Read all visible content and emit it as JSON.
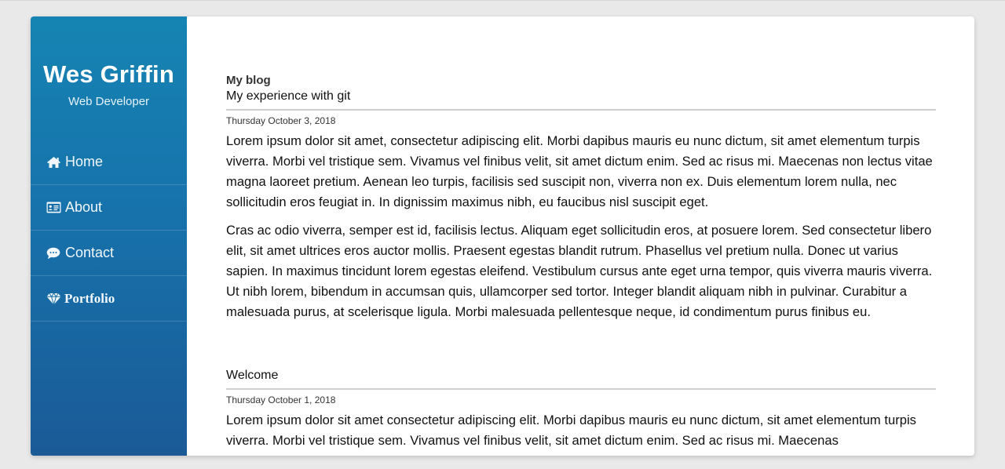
{
  "sidebar": {
    "name": "Wes Griffin",
    "subtitle": "Web Developer",
    "items": [
      {
        "label": "Home",
        "icon": "home-icon"
      },
      {
        "label": "About",
        "icon": "id-card-icon"
      },
      {
        "label": "Contact",
        "icon": "chat-bubble-icon"
      },
      {
        "label": "Portfolio",
        "icon": "diamond-icon"
      }
    ]
  },
  "main": {
    "heading": "My blog",
    "posts": [
      {
        "title": "My experience with git",
        "date": "Thursday October 3, 2018",
        "paragraphs": [
          "Lorem ipsum dolor sit amet, consectetur adipiscing elit. Morbi dapibus mauris eu nunc dictum, sit amet elementum turpis viverra. Morbi vel tristique sem. Vivamus vel finibus velit, sit amet dictum enim. Sed ac risus mi. Maecenas non lectus vitae magna laoreet pretium. Aenean leo turpis, facilisis sed suscipit non, viverra non ex. Duis elementum lorem nulla, nec sollicitudin eros feugiat in. In dignissim maximus nibh, eu faucibus nisl suscipit eget.",
          "Cras ac odio viverra, semper est id, facilisis lectus. Aliquam eget sollicitudin eros, at posuere lorem. Sed consectetur libero elit, sit amet ultrices eros auctor mollis. Praesent egestas blandit rutrum. Phasellus vel pretium nulla. Donec ut varius sapien. In maximus tincidunt lorem egestas eleifend. Vestibulum cursus ante eget urna tempor, quis viverra mauris viverra. Ut nibh lorem, bibendum in accumsan quis, ullamcorper sed tortor. Integer blandit aliquam nibh in pulvinar. Curabitur a malesuada purus, at scelerisque ligula. Morbi malesuada pellentesque neque, id condimentum purus finibus eu."
        ]
      },
      {
        "title": "Welcome",
        "date": "Thursday October 1, 2018",
        "paragraphs": [
          "Lorem ipsum dolor sit amet consectetur adipiscing elit. Morbi dapibus mauris eu nunc dictum, sit amet elementum turpis viverra. Morbi vel tristique sem. Vivamus vel finibus velit, sit amet dictum enim. Sed ac risus mi. Maecenas"
        ]
      }
    ]
  },
  "colors": {
    "sidebar_top": "#1584b3",
    "sidebar_bottom": "#1a5a97",
    "text": "#111111",
    "divider": "#cfcfcf"
  }
}
